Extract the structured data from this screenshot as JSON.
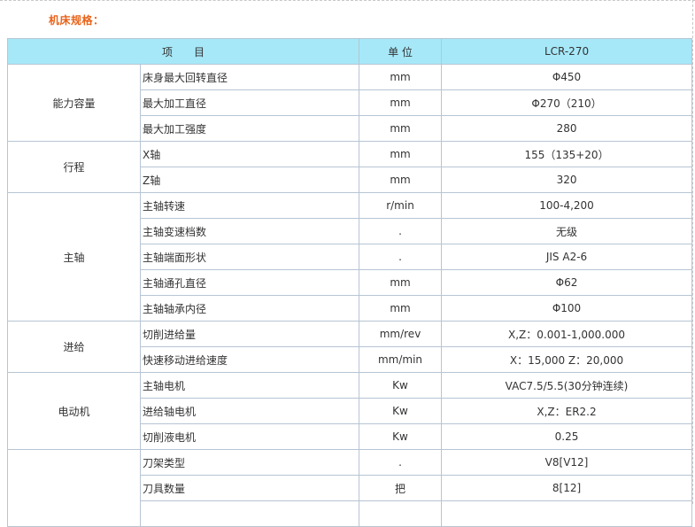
{
  "section_title": "机床规格：",
  "header": {
    "item": "项　　目",
    "unit": "单 位",
    "model": "LCR-270"
  },
  "groups": [
    {
      "name": "能力容量",
      "rows": [
        {
          "item": "床身最大回转直径",
          "unit": "mm",
          "value": "Φ450"
        },
        {
          "item": "最大加工直径",
          "unit": "mm",
          "value": "Φ270（210）"
        },
        {
          "item": "最大加工强度",
          "unit": "mm",
          "value": "280"
        }
      ]
    },
    {
      "name": "行程",
      "rows": [
        {
          "item": "X轴",
          "unit": "mm",
          "value": "155（135+20）"
        },
        {
          "item": "Z轴",
          "unit": "mm",
          "value": "320"
        }
      ]
    },
    {
      "name": "主轴",
      "rows": [
        {
          "item": "主轴转速",
          "unit": "r/min",
          "value": "100-4,200"
        },
        {
          "item": "主轴变速档数",
          "unit": ".",
          "value": "无级"
        },
        {
          "item": "主轴端面形状",
          "unit": ".",
          "value": "JIS A2-6"
        },
        {
          "item": "主轴通孔直径",
          "unit": "mm",
          "value": "Φ62"
        },
        {
          "item": "主轴轴承内径",
          "unit": "mm",
          "value": "Φ100"
        }
      ]
    },
    {
      "name": "进给",
      "rows": [
        {
          "item": "切削进给量",
          "unit": "mm/rev",
          "value": "X,Z：0.001-1,000.000"
        },
        {
          "item": "快速移动进给速度",
          "unit": "mm/min",
          "value": "X：15,000 Z：20,000"
        }
      ]
    },
    {
      "name": "电动机",
      "rows": [
        {
          "item": "主轴电机",
          "unit": "Kw",
          "value": "VAC7.5/5.5(30分钟连续)"
        },
        {
          "item": "进给轴电机",
          "unit": "Kw",
          "value": "X,Z：ER2.2"
        },
        {
          "item": "切削液电机",
          "unit": "Kw",
          "value": "0.25"
        }
      ]
    },
    {
      "name": "",
      "rows": [
        {
          "item": "刀架类型",
          "unit": ".",
          "value": "V8[V12]"
        },
        {
          "item": "刀具数量",
          "unit": "把",
          "value": "8[12]"
        },
        {
          "item": "",
          "unit": "",
          "value": ""
        }
      ]
    }
  ]
}
